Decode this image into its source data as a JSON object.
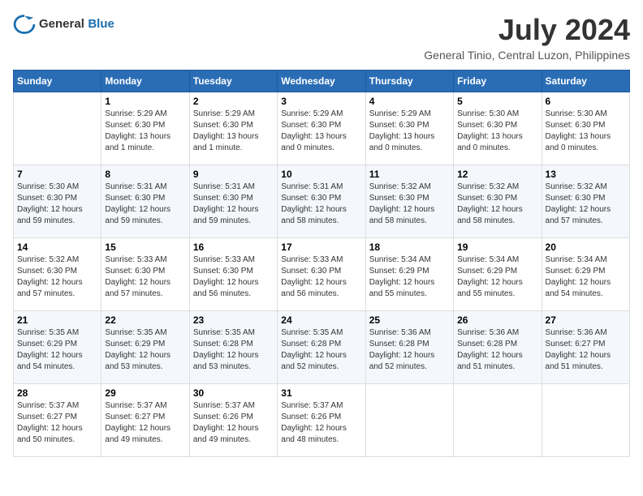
{
  "app": {
    "logo_general": "General",
    "logo_blue": "Blue"
  },
  "title": "July 2024",
  "location": "General Tinio, Central Luzon, Philippines",
  "days_of_week": [
    "Sunday",
    "Monday",
    "Tuesday",
    "Wednesday",
    "Thursday",
    "Friday",
    "Saturday"
  ],
  "weeks": [
    [
      {
        "day": "",
        "sunrise": "",
        "sunset": "",
        "daylight": ""
      },
      {
        "day": "1",
        "sunrise": "Sunrise: 5:29 AM",
        "sunset": "Sunset: 6:30 PM",
        "daylight": "Daylight: 13 hours and 1 minute."
      },
      {
        "day": "2",
        "sunrise": "Sunrise: 5:29 AM",
        "sunset": "Sunset: 6:30 PM",
        "daylight": "Daylight: 13 hours and 1 minute."
      },
      {
        "day": "3",
        "sunrise": "Sunrise: 5:29 AM",
        "sunset": "Sunset: 6:30 PM",
        "daylight": "Daylight: 13 hours and 0 minutes."
      },
      {
        "day": "4",
        "sunrise": "Sunrise: 5:29 AM",
        "sunset": "Sunset: 6:30 PM",
        "daylight": "Daylight: 13 hours and 0 minutes."
      },
      {
        "day": "5",
        "sunrise": "Sunrise: 5:30 AM",
        "sunset": "Sunset: 6:30 PM",
        "daylight": "Daylight: 13 hours and 0 minutes."
      },
      {
        "day": "6",
        "sunrise": "Sunrise: 5:30 AM",
        "sunset": "Sunset: 6:30 PM",
        "daylight": "Daylight: 13 hours and 0 minutes."
      }
    ],
    [
      {
        "day": "7",
        "sunrise": "Sunrise: 5:30 AM",
        "sunset": "Sunset: 6:30 PM",
        "daylight": "Daylight: 12 hours and 59 minutes."
      },
      {
        "day": "8",
        "sunrise": "Sunrise: 5:31 AM",
        "sunset": "Sunset: 6:30 PM",
        "daylight": "Daylight: 12 hours and 59 minutes."
      },
      {
        "day": "9",
        "sunrise": "Sunrise: 5:31 AM",
        "sunset": "Sunset: 6:30 PM",
        "daylight": "Daylight: 12 hours and 59 minutes."
      },
      {
        "day": "10",
        "sunrise": "Sunrise: 5:31 AM",
        "sunset": "Sunset: 6:30 PM",
        "daylight": "Daylight: 12 hours and 58 minutes."
      },
      {
        "day": "11",
        "sunrise": "Sunrise: 5:32 AM",
        "sunset": "Sunset: 6:30 PM",
        "daylight": "Daylight: 12 hours and 58 minutes."
      },
      {
        "day": "12",
        "sunrise": "Sunrise: 5:32 AM",
        "sunset": "Sunset: 6:30 PM",
        "daylight": "Daylight: 12 hours and 58 minutes."
      },
      {
        "day": "13",
        "sunrise": "Sunrise: 5:32 AM",
        "sunset": "Sunset: 6:30 PM",
        "daylight": "Daylight: 12 hours and 57 minutes."
      }
    ],
    [
      {
        "day": "14",
        "sunrise": "Sunrise: 5:32 AM",
        "sunset": "Sunset: 6:30 PM",
        "daylight": "Daylight: 12 hours and 57 minutes."
      },
      {
        "day": "15",
        "sunrise": "Sunrise: 5:33 AM",
        "sunset": "Sunset: 6:30 PM",
        "daylight": "Daylight: 12 hours and 57 minutes."
      },
      {
        "day": "16",
        "sunrise": "Sunrise: 5:33 AM",
        "sunset": "Sunset: 6:30 PM",
        "daylight": "Daylight: 12 hours and 56 minutes."
      },
      {
        "day": "17",
        "sunrise": "Sunrise: 5:33 AM",
        "sunset": "Sunset: 6:30 PM",
        "daylight": "Daylight: 12 hours and 56 minutes."
      },
      {
        "day": "18",
        "sunrise": "Sunrise: 5:34 AM",
        "sunset": "Sunset: 6:29 PM",
        "daylight": "Daylight: 12 hours and 55 minutes."
      },
      {
        "day": "19",
        "sunrise": "Sunrise: 5:34 AM",
        "sunset": "Sunset: 6:29 PM",
        "daylight": "Daylight: 12 hours and 55 minutes."
      },
      {
        "day": "20",
        "sunrise": "Sunrise: 5:34 AM",
        "sunset": "Sunset: 6:29 PM",
        "daylight": "Daylight: 12 hours and 54 minutes."
      }
    ],
    [
      {
        "day": "21",
        "sunrise": "Sunrise: 5:35 AM",
        "sunset": "Sunset: 6:29 PM",
        "daylight": "Daylight: 12 hours and 54 minutes."
      },
      {
        "day": "22",
        "sunrise": "Sunrise: 5:35 AM",
        "sunset": "Sunset: 6:29 PM",
        "daylight": "Daylight: 12 hours and 53 minutes."
      },
      {
        "day": "23",
        "sunrise": "Sunrise: 5:35 AM",
        "sunset": "Sunset: 6:28 PM",
        "daylight": "Daylight: 12 hours and 53 minutes."
      },
      {
        "day": "24",
        "sunrise": "Sunrise: 5:35 AM",
        "sunset": "Sunset: 6:28 PM",
        "daylight": "Daylight: 12 hours and 52 minutes."
      },
      {
        "day": "25",
        "sunrise": "Sunrise: 5:36 AM",
        "sunset": "Sunset: 6:28 PM",
        "daylight": "Daylight: 12 hours and 52 minutes."
      },
      {
        "day": "26",
        "sunrise": "Sunrise: 5:36 AM",
        "sunset": "Sunset: 6:28 PM",
        "daylight": "Daylight: 12 hours and 51 minutes."
      },
      {
        "day": "27",
        "sunrise": "Sunrise: 5:36 AM",
        "sunset": "Sunset: 6:27 PM",
        "daylight": "Daylight: 12 hours and 51 minutes."
      }
    ],
    [
      {
        "day": "28",
        "sunrise": "Sunrise: 5:37 AM",
        "sunset": "Sunset: 6:27 PM",
        "daylight": "Daylight: 12 hours and 50 minutes."
      },
      {
        "day": "29",
        "sunrise": "Sunrise: 5:37 AM",
        "sunset": "Sunset: 6:27 PM",
        "daylight": "Daylight: 12 hours and 49 minutes."
      },
      {
        "day": "30",
        "sunrise": "Sunrise: 5:37 AM",
        "sunset": "Sunset: 6:26 PM",
        "daylight": "Daylight: 12 hours and 49 minutes."
      },
      {
        "day": "31",
        "sunrise": "Sunrise: 5:37 AM",
        "sunset": "Sunset: 6:26 PM",
        "daylight": "Daylight: 12 hours and 48 minutes."
      },
      {
        "day": "",
        "sunrise": "",
        "sunset": "",
        "daylight": ""
      },
      {
        "day": "",
        "sunrise": "",
        "sunset": "",
        "daylight": ""
      },
      {
        "day": "",
        "sunrise": "",
        "sunset": "",
        "daylight": ""
      }
    ]
  ]
}
